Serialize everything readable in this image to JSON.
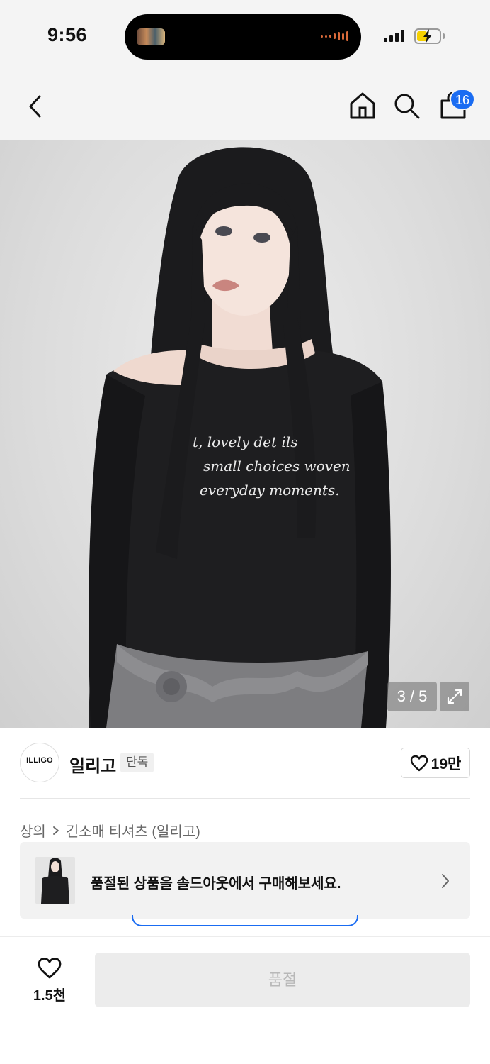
{
  "status_bar": {
    "time": "9:56",
    "battery_level": 0.45,
    "battery_color": "#f5d000",
    "icons": [
      "signal-icon",
      "battery-charging-icon"
    ]
  },
  "nav": {
    "icons": [
      "back-icon",
      "home-icon",
      "search-icon",
      "cart-icon"
    ],
    "cart_badge": "16",
    "badge_color": "#1a6cf2"
  },
  "gallery": {
    "counter": "3 / 5",
    "shirt_print": [
      "t, lovely det ils",
      "small choices woven",
      "everyday moments."
    ]
  },
  "brand": {
    "logo_text": "ILLIGO",
    "name": "일리고",
    "badge": "단독",
    "likes": "19만"
  },
  "breadcrumb": {
    "items": [
      "상의",
      "긴소매 티셔츠 (일리고)"
    ]
  },
  "soldout_banner": {
    "text": "품절된 상품을 솔드아웃에서 구매해보세요."
  },
  "bottom_bar": {
    "wish_count": "1.5천",
    "buy_button": "품절"
  }
}
